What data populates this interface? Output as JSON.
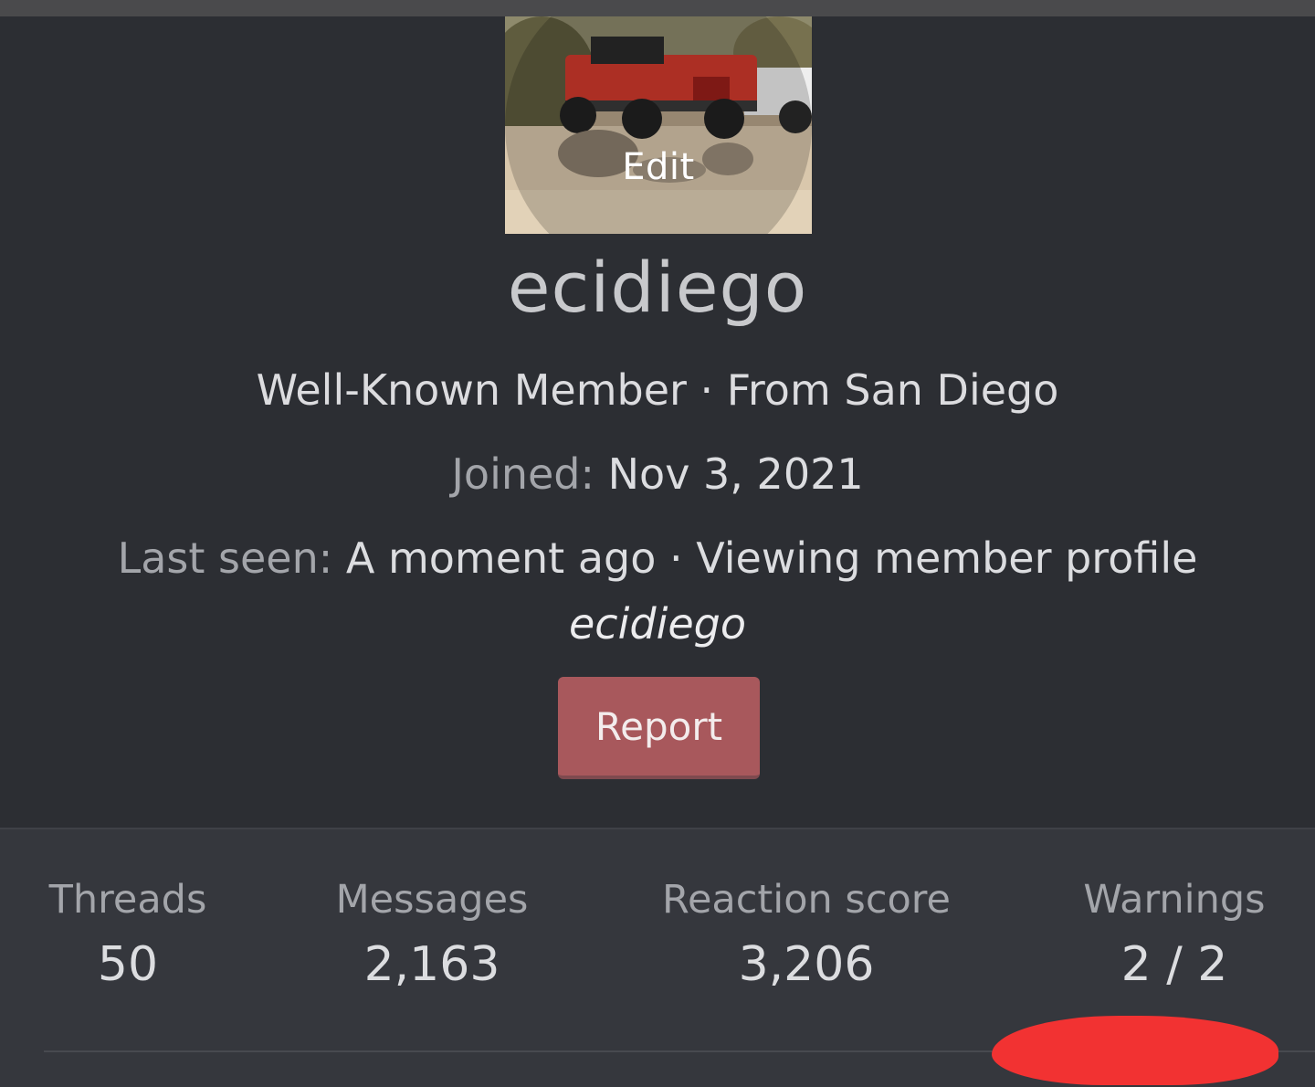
{
  "avatar": {
    "edit_label": "Edit"
  },
  "profile": {
    "username": "ecidiego",
    "title": "Well-Known Member · From San Diego",
    "joined_label": "Joined:",
    "joined_value": "Nov 3, 2021",
    "last_seen_label": "Last seen:",
    "last_seen_value": "A moment ago · Viewing member profile",
    "activity_target": "ecidiego"
  },
  "actions": {
    "report_label": "Report",
    "report_color": "#a8585c"
  },
  "stats": [
    {
      "label": "Threads",
      "value": "50"
    },
    {
      "label": "Messages",
      "value": "2,163"
    },
    {
      "label": "Reaction score",
      "value": "3,206"
    },
    {
      "label": "Warnings",
      "value": "2 / 2"
    }
  ],
  "colors": {
    "background": "#2c2e33",
    "stats_background": "#35373d",
    "annotation": "#f23232"
  }
}
